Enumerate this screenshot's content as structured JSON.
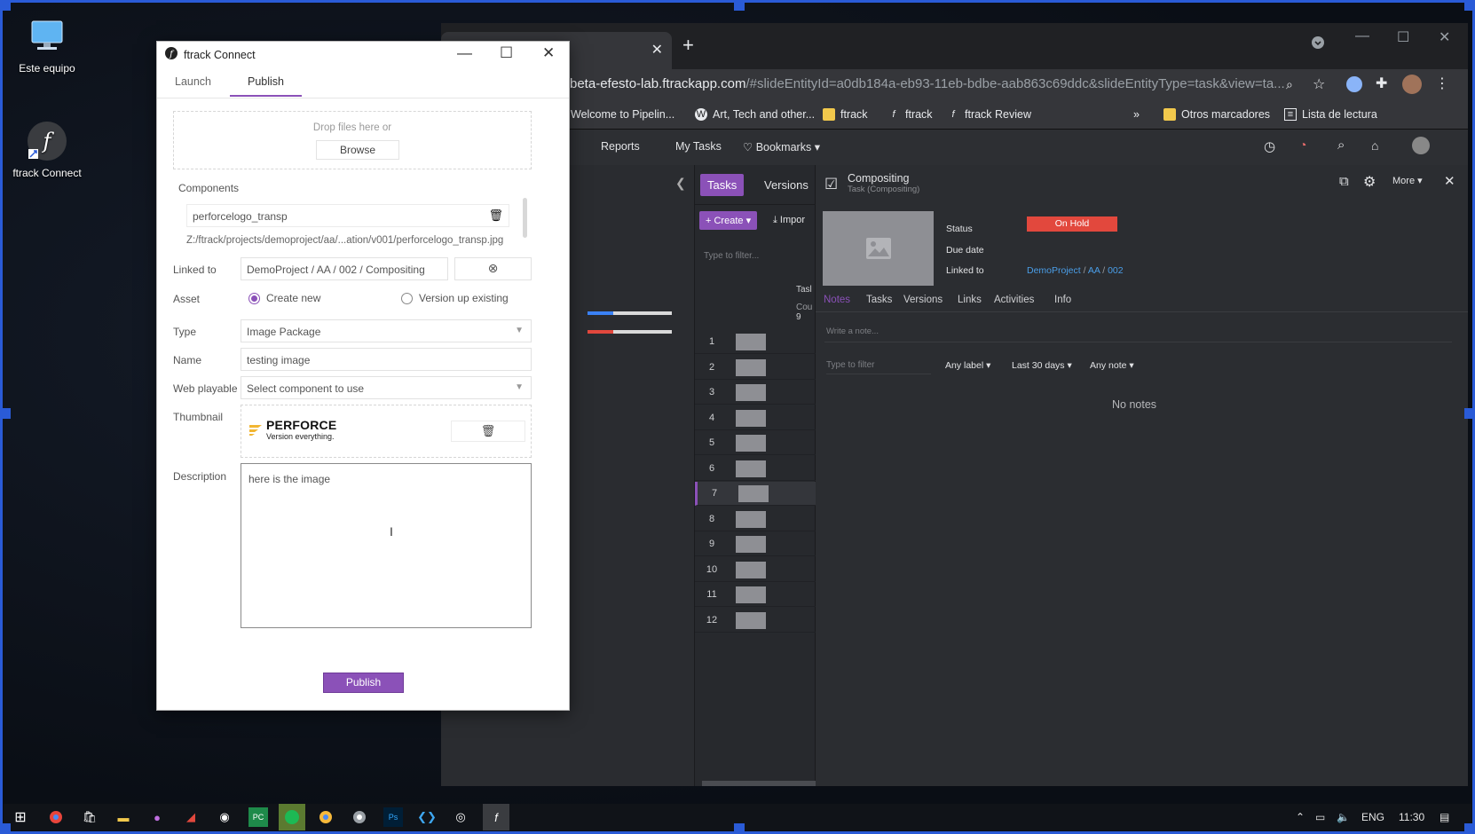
{
  "desktop": {
    "icons": [
      {
        "label": "Este equipo"
      },
      {
        "label": "ftrack Connect"
      }
    ]
  },
  "browser": {
    "url_host": "beta-efesto-lab.ftrackapp.com",
    "url_path": "/#slideEntityId=a0db184a-eb93-11eb-bdbe-aab863c69ddc&slideEntityType=task&view=ta...",
    "bookmarks": [
      "Welcome to Pipelin...",
      "Art, Tech and other...",
      "ftrack",
      "ftrack",
      "ftrack Review",
      "Otros marcadores",
      "Lista de lectura"
    ],
    "bookmarks_overflow": "»"
  },
  "ftrack_web": {
    "nav": [
      "Reports",
      "My Tasks",
      "Bookmarks"
    ],
    "tabs": {
      "tasks": "Tasks",
      "versions": "Versions"
    },
    "create_label": "Create",
    "import_label": "Impor",
    "filter_placeholder": "Type to filter...",
    "col_task": "Tasl",
    "col_count": "Cou",
    "col_count_val": "9",
    "rows": [
      "1",
      "2",
      "3",
      "4",
      "5",
      "6",
      "7",
      "8",
      "9",
      "10",
      "11",
      "12"
    ],
    "selected_row": "7",
    "detail": {
      "title": "Compositing",
      "subtitle": "Task (Compositing)",
      "more_label": "More",
      "status_label": "Status",
      "status_value": "On Hold",
      "status_color": "#e2483d",
      "due_label": "Due date",
      "linked_label": "Linked to",
      "linked_parts": [
        "DemoProject",
        "AA",
        "002"
      ],
      "tabs": [
        "Notes",
        "Tasks",
        "Versions",
        "Links",
        "Activities",
        "Info"
      ],
      "note_placeholder": "Write a note...",
      "filter_placeholder": "Type to filter",
      "filters": [
        "Any label",
        "Last 30 days",
        "Any note"
      ],
      "empty": "No notes"
    }
  },
  "dialog": {
    "title": "ftrack Connect",
    "tabs": [
      "Launch",
      "Publish"
    ],
    "active_tab": "Publish",
    "drop_text": "Drop files here or",
    "browse_label": "Browse",
    "components_label": "Components",
    "component_name": "perforcelogo_transp",
    "component_path": "Z:/ftrack/projects/demoproject/aa/...ation/v001/perforcelogo_transp.jpg",
    "linked_label": "Linked to",
    "linked_value": "DemoProject / AA / 002 / Compositing",
    "asset_label": "Asset",
    "asset_opt_new": "Create new",
    "asset_opt_existing": "Version up existing",
    "type_label": "Type",
    "type_value": "Image Package",
    "name_label": "Name",
    "name_value": "testing image",
    "webplayable_label": "Web playable",
    "webplayable_value": "Select component to use",
    "thumbnail_label": "Thumbnail",
    "thumb_brand": "PERFORCE",
    "thumb_tagline": "Version everything.",
    "description_label": "Description",
    "description_value": "here is the image",
    "publish_label": "Publish",
    "accent": "#8b51b8"
  },
  "taskbar": {
    "lang": "ENG",
    "time": "11:30"
  }
}
